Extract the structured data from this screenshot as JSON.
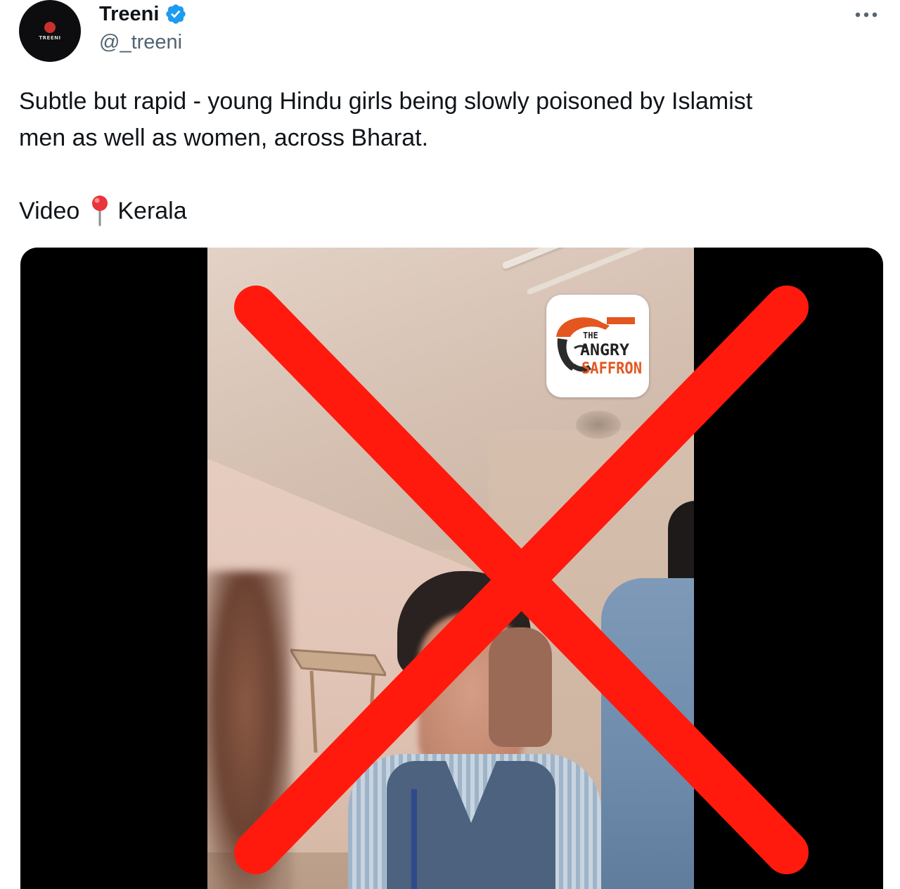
{
  "tweet": {
    "author": {
      "display_name": "Treeni",
      "handle": "@_treeni",
      "verified": true,
      "avatar_text": "TREENI",
      "avatar_icon": "avatar-logo-icon"
    },
    "text_lines": [
      "Subtle but rapid - young Hindu girls being slowly poisoned by Islamist",
      "men as well as women, across Bharat."
    ],
    "location_prefix": "Video",
    "location_icon": "round-pushpin-icon",
    "location_name": "Kerala",
    "more_icon": "more-options-icon",
    "media": {
      "type": "video",
      "watermark": {
        "line1": "THE",
        "line2": "ANGRY",
        "line3": "SAFFRON"
      },
      "overlay": "red-x-icon"
    }
  },
  "colors": {
    "verified_blue": "#1d9bf0",
    "handle_gray": "#536471",
    "cross_red": "#ff1a0d",
    "saffron": "#e4561f"
  }
}
